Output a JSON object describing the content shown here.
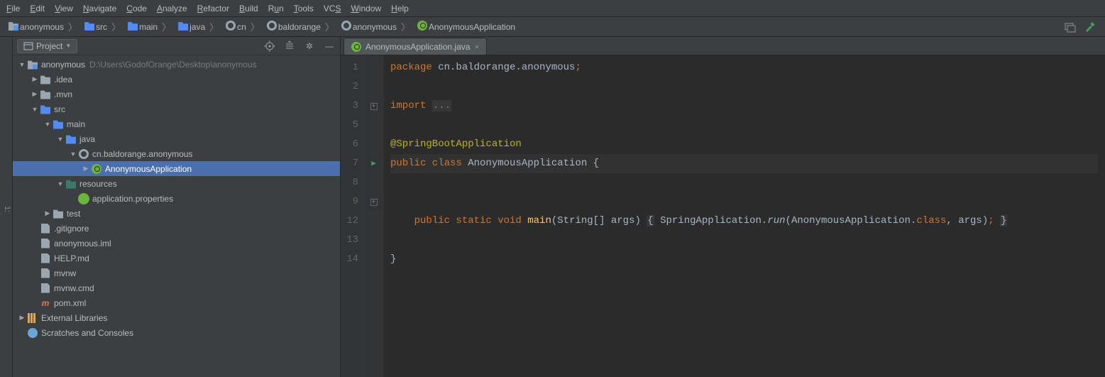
{
  "menu": {
    "items": [
      {
        "label": "File",
        "underline": "F",
        "rest": "ile"
      },
      {
        "label": "Edit",
        "underline": "E",
        "rest": "dit"
      },
      {
        "label": "View",
        "underline": "V",
        "rest": "iew"
      },
      {
        "label": "Navigate",
        "underline": "N",
        "rest": "avigate"
      },
      {
        "label": "Code",
        "underline": "C",
        "rest": "ode"
      },
      {
        "label": "Analyze",
        "underline": "A",
        "rest": "nalyze"
      },
      {
        "label": "Refactor",
        "underline": "R",
        "rest": "efactor"
      },
      {
        "label": "Build",
        "underline": "B",
        "rest": "uild"
      },
      {
        "label": "Run",
        "underline": "R",
        "rest": "un",
        "pre": ""
      },
      {
        "label": "Tools",
        "underline": "T",
        "rest": "ools"
      },
      {
        "label": "VCS",
        "underline": "S",
        "rest": "",
        "prefix": "VC"
      },
      {
        "label": "Window",
        "underline": "W",
        "rest": "indow"
      },
      {
        "label": "Help",
        "underline": "H",
        "rest": "elp"
      }
    ]
  },
  "breadcrumb": {
    "items": [
      {
        "icon": "folder-root",
        "text": "anonymous"
      },
      {
        "icon": "folder-blue",
        "text": "src"
      },
      {
        "icon": "folder-blue",
        "text": "main"
      },
      {
        "icon": "folder-blue",
        "text": "java"
      },
      {
        "icon": "pkg",
        "text": "cn"
      },
      {
        "icon": "pkg",
        "text": "baldorange"
      },
      {
        "icon": "pkg",
        "text": "anonymous"
      },
      {
        "icon": "spring",
        "text": "AnonymousApplication"
      }
    ]
  },
  "project_panel": {
    "title": "Project",
    "tree": [
      {
        "depth": 0,
        "open": true,
        "icon": "folder-root",
        "label": "anonymous",
        "suffix": "D:\\Users\\GodofOrange\\Desktop\\anonymous",
        "selected": false
      },
      {
        "depth": 1,
        "open": false,
        "icon": "folder",
        "label": ".idea"
      },
      {
        "depth": 1,
        "open": false,
        "icon": "folder",
        "label": ".mvn"
      },
      {
        "depth": 1,
        "open": true,
        "icon": "folder-blue",
        "label": "src"
      },
      {
        "depth": 2,
        "open": true,
        "icon": "folder-blue",
        "label": "main"
      },
      {
        "depth": 3,
        "open": true,
        "icon": "folder-blue",
        "label": "java"
      },
      {
        "depth": 4,
        "open": true,
        "icon": "pkg",
        "label": "cn.baldorange.anonymous"
      },
      {
        "depth": 5,
        "open": false,
        "icon": "spring",
        "label": "AnonymousApplication",
        "selected": true
      },
      {
        "depth": 3,
        "open": true,
        "icon": "folder-teal",
        "label": "resources"
      },
      {
        "depth": 4,
        "open": null,
        "icon": "spring-file",
        "label": "application.properties"
      },
      {
        "depth": 2,
        "open": false,
        "icon": "folder",
        "label": "test"
      },
      {
        "depth": 1,
        "open": null,
        "icon": "file",
        "label": ".gitignore"
      },
      {
        "depth": 1,
        "open": null,
        "icon": "file",
        "label": "anonymous.iml"
      },
      {
        "depth": 1,
        "open": null,
        "icon": "file",
        "label": "HELP.md"
      },
      {
        "depth": 1,
        "open": null,
        "icon": "file",
        "label": "mvnw"
      },
      {
        "depth": 1,
        "open": null,
        "icon": "file",
        "label": "mvnw.cmd"
      },
      {
        "depth": 1,
        "open": null,
        "icon": "file-m",
        "label": "pom.xml"
      },
      {
        "depth": 0,
        "open": false,
        "icon": "lib",
        "label": "External Libraries"
      },
      {
        "depth": 0,
        "open": null,
        "icon": "scratch",
        "label": "Scratches and Consoles"
      }
    ]
  },
  "tabs": {
    "active": {
      "icon": "spring",
      "label": "AnonymousApplication.java"
    }
  },
  "editor": {
    "line_numbers": [
      "1",
      "2",
      "3",
      "5",
      "6",
      "7",
      "8",
      "9",
      "12",
      "13",
      "14"
    ],
    "run_marker_line_index": 5,
    "fold_boxes": [
      2,
      7
    ],
    "code_lines": [
      {
        "segments": [
          {
            "cls": "kw",
            "t": "package"
          },
          {
            "cls": "",
            "t": " cn.baldorange.anonymous"
          },
          {
            "cls": "kw",
            "t": ";"
          }
        ]
      },
      {
        "segments": [
          {
            "cls": "",
            "t": ""
          }
        ]
      },
      {
        "segments": [
          {
            "cls": "kw",
            "t": "import "
          },
          {
            "cls": "dim block-hi",
            "t": "..."
          }
        ]
      },
      {
        "segments": [
          {
            "cls": "",
            "t": ""
          }
        ]
      },
      {
        "segments": [
          {
            "cls": "ann",
            "t": "@SpringBootApplication"
          }
        ]
      },
      {
        "current": true,
        "segments": [
          {
            "cls": "kw",
            "t": "public class"
          },
          {
            "cls": "",
            "t": " AnonymousApplication {"
          }
        ]
      },
      {
        "segments": [
          {
            "cls": "",
            "t": ""
          }
        ]
      },
      {
        "segments": [
          {
            "cls": "",
            "t": "    "
          },
          {
            "cls": "kw",
            "t": "public static void"
          },
          {
            "cls": "",
            "t": " "
          },
          {
            "cls": "fn",
            "t": "main"
          },
          {
            "cls": "",
            "t": "(String[] args) "
          },
          {
            "cls": "block-hi",
            "t": "{"
          },
          {
            "cls": "",
            "t": " SpringApplication."
          },
          {
            "cls": "italic",
            "t": "run"
          },
          {
            "cls": "",
            "t": "(AnonymousApplication."
          },
          {
            "cls": "kw",
            "t": "class"
          },
          {
            "cls": "",
            "t": ", args)"
          },
          {
            "cls": "kw",
            "t": ";"
          },
          {
            "cls": "",
            "t": " "
          },
          {
            "cls": "block-hi",
            "t": "}"
          }
        ]
      },
      {
        "segments": [
          {
            "cls": "",
            "t": ""
          }
        ]
      },
      {
        "segments": [
          {
            "cls": "",
            "t": "}"
          }
        ]
      },
      {
        "segments": [
          {
            "cls": "",
            "t": ""
          }
        ]
      }
    ]
  },
  "sidebar_tab_label": "Project"
}
